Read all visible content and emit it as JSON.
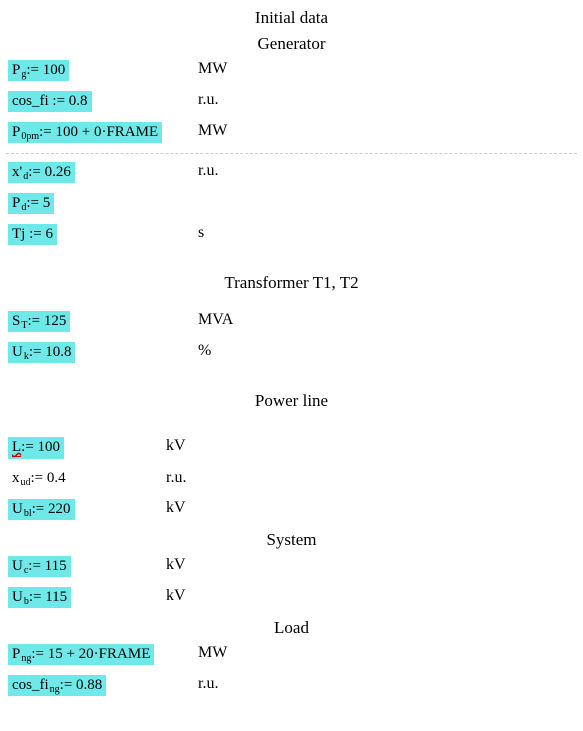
{
  "titles": {
    "initial": "Initial data",
    "generator": "Generator",
    "transformer": "Transformer T1, T2",
    "powerline": "Power line",
    "system": "System",
    "load": "Load"
  },
  "generator": {
    "Pg": {
      "base": "P",
      "sub": "g",
      "expr": " := 100",
      "unit": "MW"
    },
    "cosfi": {
      "label": "cos_fi := 0.8",
      "unit": "r.u."
    },
    "P0pm": {
      "base": "P",
      "sub": "0pm",
      "expr": " := 100 + 0·FRAME",
      "unit": "MW"
    },
    "xd": {
      "base": "x'",
      "sub": "d",
      "expr": " := 0.26",
      "unit": "r.u."
    },
    "Pd": {
      "base": "P",
      "sub": "d",
      "expr": " := 5",
      "unit": ""
    },
    "Tj": {
      "label": "Tj := 6",
      "unit": "s"
    }
  },
  "transformer": {
    "ST": {
      "base": "S",
      "sub": "T",
      "expr": " := 125",
      "unit": "MVA"
    },
    "Uk": {
      "base": "U",
      "sub": "k",
      "expr": " := 10.8",
      "unit": "%"
    }
  },
  "powerline": {
    "L": {
      "base": "L",
      "sub": "",
      "expr": " := 100",
      "unit": "kV"
    },
    "xud": {
      "base": "x",
      "sub": "ud",
      "expr": " := 0.4",
      "unit": "r.u."
    },
    "Ubl": {
      "base": "U",
      "sub": "bl",
      "expr": " := 220",
      "unit": "kV"
    }
  },
  "system": {
    "Uc": {
      "base": "U",
      "sub": "c",
      "expr": " := 115",
      "unit": "kV"
    },
    "Ub": {
      "base": "U",
      "sub": "b",
      "expr": " := 115",
      "unit": "kV"
    }
  },
  "load": {
    "Png": {
      "base": "P",
      "sub": "ng",
      "expr": " := 15 + 20·FRAME",
      "unit": "MW"
    },
    "cosfi_ng": {
      "base": "cos_fi",
      "sub": "ng",
      "expr": " := 0.88",
      "unit": "r.u."
    }
  }
}
